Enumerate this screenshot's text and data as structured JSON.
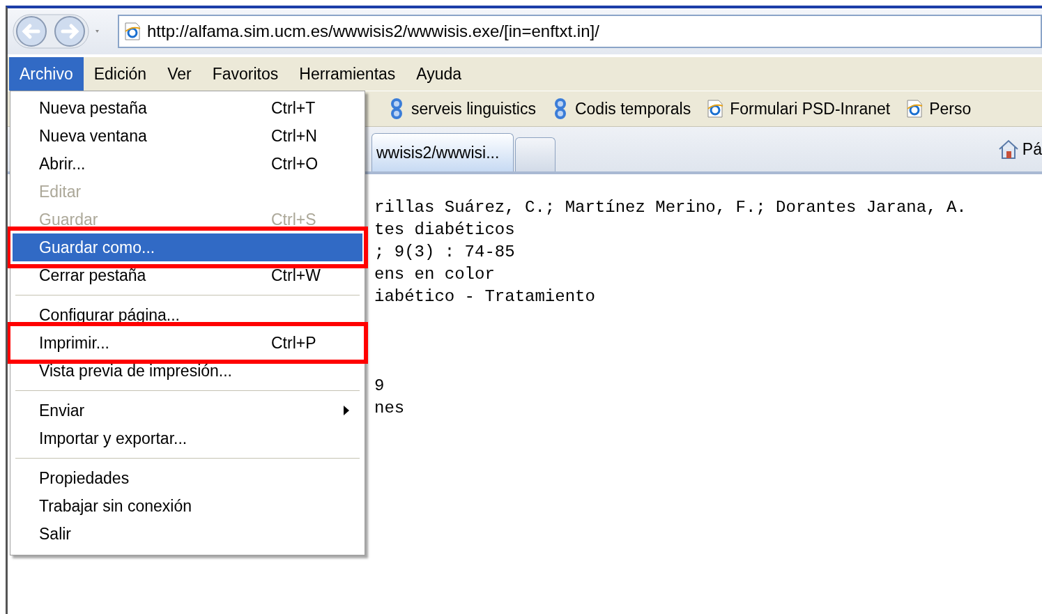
{
  "address_bar": {
    "url": "http://alfama.sim.ucm.es/wwwisis2/wwwisis.exe/[in=enftxt.in]/"
  },
  "menu_bar": [
    {
      "label": "Archivo",
      "selected": true
    },
    {
      "label": "Edición",
      "selected": false
    },
    {
      "label": "Ver",
      "selected": false
    },
    {
      "label": "Favoritos",
      "selected": false
    },
    {
      "label": "Herramientas",
      "selected": false
    },
    {
      "label": "Ayuda",
      "selected": false
    }
  ],
  "favorites_bar": [
    {
      "label": "serveis linguistics",
      "kind": "ls"
    },
    {
      "label": "Codis temporals",
      "kind": "ls"
    },
    {
      "label": "Formulari  PSD-Inranet",
      "kind": "ie"
    },
    {
      "label": "Perso",
      "kind": "ie"
    }
  ],
  "tabs": [
    {
      "label": "wwisis2/wwwisi...",
      "kind": "page"
    },
    {
      "kind": "new"
    }
  ],
  "home_button": {
    "label": "Pá"
  },
  "page_blocks": [
    [
      "rillas Suárez, C.; Martínez Merino, F.; Dorantes Jarana, A.",
      "tes diabéticos",
      "; 9(3) : 74-85",
      "ens en color",
      "iabético - Tratamiento"
    ],
    [
      "9",
      "nes"
    ]
  ],
  "file_menu": [
    {
      "kind": "item",
      "label": "Nueva pestaña",
      "shortcut": "Ctrl+T",
      "disabled": false,
      "selected": false,
      "outlined": false
    },
    {
      "kind": "item",
      "label": "Nueva ventana",
      "shortcut": "Ctrl+N",
      "disabled": false,
      "selected": false,
      "outlined": false
    },
    {
      "kind": "item",
      "label": "Abrir...",
      "shortcut": "Ctrl+O",
      "disabled": false,
      "selected": false,
      "outlined": false
    },
    {
      "kind": "item",
      "label": "Editar",
      "disabled": true,
      "selected": false,
      "outlined": false
    },
    {
      "kind": "item",
      "label": "Guardar",
      "shortcut": "Ctrl+S",
      "disabled": true,
      "selected": false,
      "outlined": false
    },
    {
      "kind": "item",
      "label": "Guardar como...",
      "disabled": false,
      "selected": true,
      "outlined": true
    },
    {
      "kind": "item",
      "label": "Cerrar pestaña",
      "shortcut": "Ctrl+W",
      "disabled": false,
      "selected": false,
      "outlined": false
    },
    {
      "kind": "separator"
    },
    {
      "kind": "item",
      "label": "Configurar página...",
      "disabled": false,
      "selected": false,
      "outlined": false
    },
    {
      "kind": "item",
      "label": "Imprimir...",
      "shortcut": "Ctrl+P",
      "disabled": false,
      "selected": false,
      "outlined": true
    },
    {
      "kind": "item",
      "label": "Vista previa de impresión...",
      "disabled": false,
      "selected": false,
      "outlined": false
    },
    {
      "kind": "separator"
    },
    {
      "kind": "item",
      "label": "Enviar",
      "disabled": false,
      "selected": false,
      "outlined": false,
      "submenu": true
    },
    {
      "kind": "item",
      "label": "Importar y exportar...",
      "disabled": false,
      "selected": false,
      "outlined": false
    },
    {
      "kind": "separator"
    },
    {
      "kind": "item",
      "label": "Propiedades",
      "disabled": false,
      "selected": false,
      "outlined": false
    },
    {
      "kind": "item",
      "label": "Trabajar sin conexión",
      "disabled": false,
      "selected": false,
      "outlined": false
    },
    {
      "kind": "item",
      "label": "Salir",
      "disabled": false,
      "selected": false,
      "outlined": false
    }
  ]
}
